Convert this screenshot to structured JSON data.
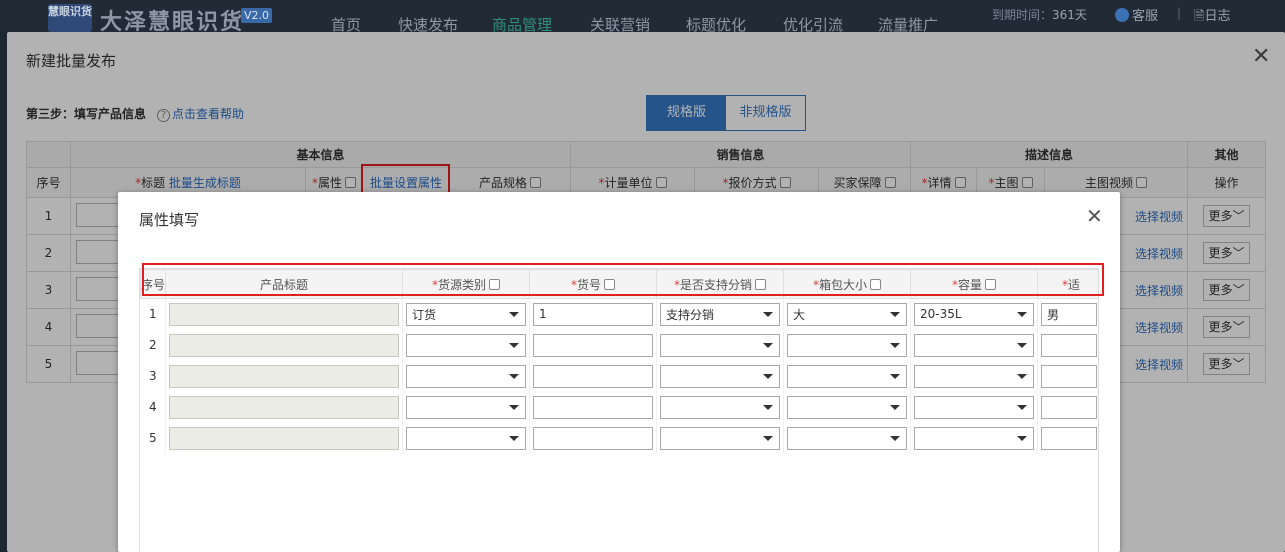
{
  "app": {
    "logo": "慧眼识货",
    "brand": "大泽慧眼识货",
    "version": "V2.0",
    "nav": [
      "首页",
      "快速发布",
      "商品管理",
      "关联营销",
      "标题优化",
      "优化引流",
      "流量推广"
    ],
    "active_nav": "商品管理",
    "expire_label": "到期时间：",
    "expire_value": "361天",
    "service": "客服",
    "log": "日志"
  },
  "dialog": {
    "title": "新建批量发布",
    "step": "第三步：填写产品信息",
    "help": "点击查看帮助",
    "toggle": [
      "规格版",
      "非规格版"
    ]
  },
  "grid": {
    "groups": [
      "基本信息",
      "销售信息",
      "描述信息",
      "其他"
    ],
    "cols": {
      "seq": "序号",
      "title": "标题",
      "title_link": "批量生成标题",
      "attr": "属性",
      "attr_link": "批量设置属性",
      "spec": "产品规格",
      "unit": "计量单位",
      "quote": "报价方式",
      "guarantee": "买家保障",
      "detail": "详情",
      "main_img": "主图",
      "video": "主图视频",
      "op": "操作"
    },
    "rows": [
      "1",
      "2",
      "3",
      "4",
      "5"
    ],
    "video_link": "选择视频",
    "more": "更多"
  },
  "sub": {
    "title": "属性填写",
    "headers": [
      "序号",
      "产品标题",
      "货源类别",
      "货号",
      "是否支持分销",
      "箱包大小",
      "容量",
      "适"
    ],
    "rows": [
      {
        "seq": "1",
        "source": "订货",
        "sku": "1",
        "dist": "支持分销",
        "size": "大",
        "cap": "20-35L",
        "gender": "男"
      },
      {
        "seq": "2",
        "source": "",
        "sku": "",
        "dist": "",
        "size": "",
        "cap": "",
        "gender": ""
      },
      {
        "seq": "3",
        "source": "",
        "sku": "",
        "dist": "",
        "size": "",
        "cap": "",
        "gender": ""
      },
      {
        "seq": "4",
        "source": "",
        "sku": "",
        "dist": "",
        "size": "",
        "cap": "",
        "gender": ""
      },
      {
        "seq": "5",
        "source": "",
        "sku": "",
        "dist": "",
        "size": "",
        "cap": "",
        "gender": ""
      }
    ]
  }
}
